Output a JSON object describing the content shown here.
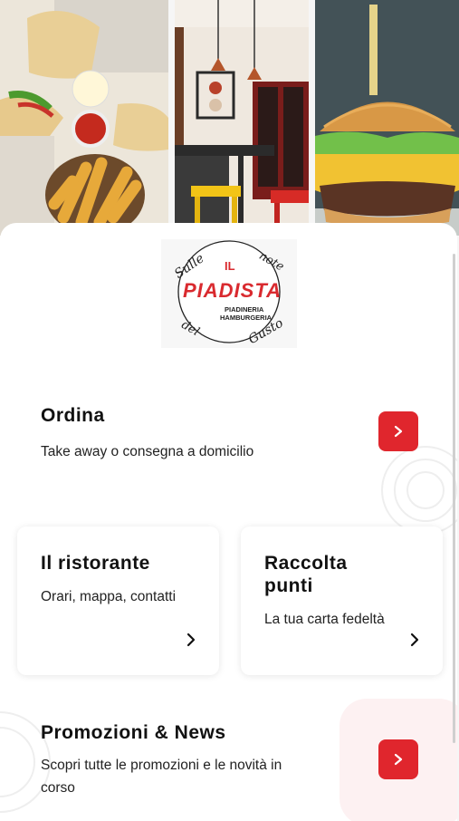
{
  "colors": {
    "accent": "#e0262d",
    "text": "#111111"
  },
  "header_photos": [
    {
      "name": "piadina-fries-photo"
    },
    {
      "name": "restaurant-interior-photo"
    },
    {
      "name": "burger-photo"
    }
  ],
  "logo": {
    "top_left": "Sulle",
    "top_right": "note",
    "brand_small": "IL",
    "brand": "PIADISTA",
    "line1": "PIADINERIA",
    "line2": "HAMBURGERIA",
    "bottom_left": "del",
    "bottom_right": "Gusto"
  },
  "sections": {
    "ordina": {
      "title": "Ordina",
      "subtitle": "Take away o consegna a domicilio"
    },
    "ristorante": {
      "title": "Il ristorante",
      "subtitle": "Orari, mappa, contatti"
    },
    "punti": {
      "title_line1": "Raccolta",
      "title_line2": "punti",
      "subtitle": "La tua carta fedeltà"
    },
    "promozioni": {
      "title": "Promozioni & News",
      "subtitle_line1": "Scopri tutte le promozioni e le novità in",
      "subtitle_line2": "corso"
    }
  }
}
